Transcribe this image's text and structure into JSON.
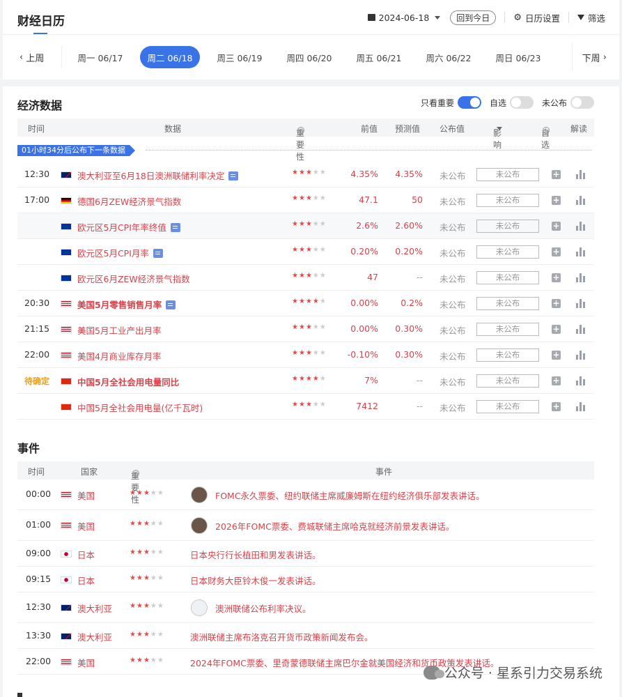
{
  "header": {
    "title": "财经日历",
    "date": "2024-06-18",
    "today_label": "回到今日",
    "settings_label": "日历设置",
    "filter_label": "筛选"
  },
  "week": {
    "prev": "上周",
    "next": "下周",
    "days": [
      "周一 06/17",
      "周二 06/18",
      "周三 06/19",
      "周四 06/20",
      "周五 06/21",
      "周六 06/22",
      "周日 06/23"
    ],
    "active_index": 1
  },
  "econ": {
    "title": "经济数据",
    "toggles": {
      "important": "只看重要",
      "favorites": "自选",
      "unreleased": "未公布"
    },
    "columns": {
      "time": "时间",
      "data": "数据",
      "importance": "重要性",
      "prev": "前值",
      "forecast": "预测值",
      "actual": "公布值",
      "impact": "影响",
      "fav": "自选",
      "analysis": "解读"
    },
    "next_release": "01小时34分后公布下一条数据",
    "rows": [
      {
        "time": "12:30",
        "flag": "au",
        "name": "澳大利亚至6月18日澳洲联储利率决定",
        "doc": true,
        "stars": 3,
        "prev": "4.35%",
        "forecast": "4.35%",
        "actual": "未公布",
        "impact": "未公布",
        "bold": false
      },
      {
        "time": "17:00",
        "flag": "de",
        "name": "德国6月ZEW经济景气指数",
        "doc": false,
        "stars": 3,
        "prev": "47.1",
        "forecast": "50",
        "actual": "未公布",
        "impact": "未公布",
        "bold": false
      },
      {
        "time": "",
        "flag": "eu",
        "name": "欧元区5月CPI年率终值",
        "doc": true,
        "stars": 3,
        "prev": "2.6%",
        "forecast": "2.60%",
        "actual": "未公布",
        "impact": "未公布",
        "bold": false,
        "highlight": true
      },
      {
        "time": "",
        "flag": "eu",
        "name": "欧元区5月CPI月率",
        "doc": true,
        "stars": 3,
        "prev": "0.20%",
        "forecast": "0.20%",
        "actual": "未公布",
        "impact": "未公布",
        "bold": false
      },
      {
        "time": "",
        "flag": "eu",
        "name": "欧元区6月ZEW经济景气指数",
        "doc": false,
        "stars": 3,
        "prev": "47",
        "forecast": "--",
        "actual": "未公布",
        "impact": "未公布",
        "bold": false
      },
      {
        "time": "20:30",
        "flag": "us",
        "name": "美国5月零售销售月率",
        "doc": true,
        "stars": 4,
        "prev": "0.00%",
        "forecast": "0.2%",
        "actual": "未公布",
        "impact": "未公布",
        "bold": true
      },
      {
        "time": "21:15",
        "flag": "us",
        "name": "美国5月工业产出月率",
        "doc": false,
        "stars": 3,
        "prev": "0.00%",
        "forecast": "0.30%",
        "actual": "未公布",
        "impact": "未公布",
        "bold": false
      },
      {
        "time": "22:00",
        "flag": "us",
        "name": "美国4月商业库存月率",
        "doc": false,
        "stars": 3,
        "prev": "-0.10%",
        "forecast": "0.30%",
        "actual": "未公布",
        "impact": "未公布",
        "bold": false
      },
      {
        "time": "待确定",
        "flag": "cn",
        "name": "中国5月全社会用电量同比",
        "doc": false,
        "stars": 4,
        "prev": "7%",
        "forecast": "--",
        "actual": "未公布",
        "impact": "未公布",
        "bold": true,
        "pending": true
      },
      {
        "time": "",
        "flag": "cn",
        "name": "中国5月全社会用电量(亿千瓦时)",
        "doc": false,
        "stars": 3,
        "prev": "7412",
        "forecast": "--",
        "actual": "未公布",
        "impact": "未公布",
        "bold": false
      }
    ]
  },
  "events": {
    "title": "事件",
    "columns": {
      "time": "时间",
      "country": "国家",
      "importance": "重要性",
      "event": "事件"
    },
    "rows": [
      {
        "time": "00:00",
        "flag": "us",
        "country": "美国",
        "stars": 3,
        "avatar": "person",
        "text": "FOMC永久票委、纽约联储主席威廉姆斯在纽约经济俱乐部发表讲话。"
      },
      {
        "time": "01:00",
        "flag": "us",
        "country": "美国",
        "stars": 3,
        "avatar": "person",
        "text": "2026年FOMC票委、费城联储主席哈克就经济前景发表讲话。"
      },
      {
        "time": "09:00",
        "flag": "jp",
        "country": "日本",
        "stars": 3,
        "avatar": "",
        "text": "日本央行行长植田和男发表讲话。"
      },
      {
        "time": "09:15",
        "flag": "jp",
        "country": "日本",
        "stars": 3,
        "avatar": "",
        "text": "日本财务大臣铃木俊一发表讲话。"
      },
      {
        "time": "12:30",
        "flag": "au",
        "country": "澳大利亚",
        "stars": 3,
        "avatar": "logo",
        "text": "澳洲联储公布利率决议。"
      },
      {
        "time": "13:30",
        "flag": "au",
        "country": "澳大利亚",
        "stars": 3,
        "avatar": "",
        "text": "澳洲联储主席布洛克召开货币政策新闻发布会。"
      },
      {
        "time": "22:00",
        "flag": "us",
        "country": "美国",
        "stars": 3,
        "avatar": "",
        "text": "2024年FOMC票委、里奇蒙德联储主席巴尔金就美国经济和货币政策发表讲话。"
      }
    ]
  },
  "watermark": "公众号 · 星系引力交易系统",
  "colors": {
    "accent": "#3a73e8",
    "red": "#e24a4a",
    "pending": "#e8a020"
  }
}
